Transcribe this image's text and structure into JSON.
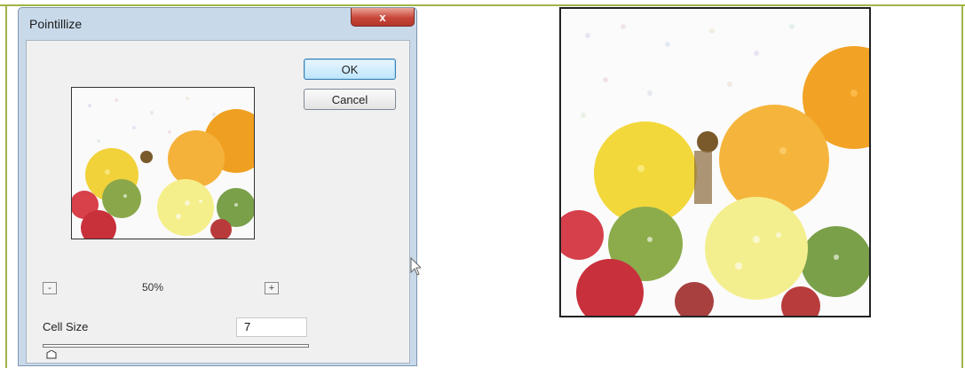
{
  "dialog": {
    "title": "Pointillize",
    "close_label": "x",
    "ok_label": "OK",
    "cancel_label": "Cancel",
    "zoom_level": "50%",
    "zoom_out_label": "-",
    "zoom_in_label": "+",
    "cell_size_label": "Cell Size",
    "cell_size_value": "7",
    "cell_size_slider_fraction": 0.02
  },
  "colors": {
    "frame": "#9fb54a",
    "dialog_bg": "#c8d9ea",
    "close_red": "#c8473a"
  }
}
